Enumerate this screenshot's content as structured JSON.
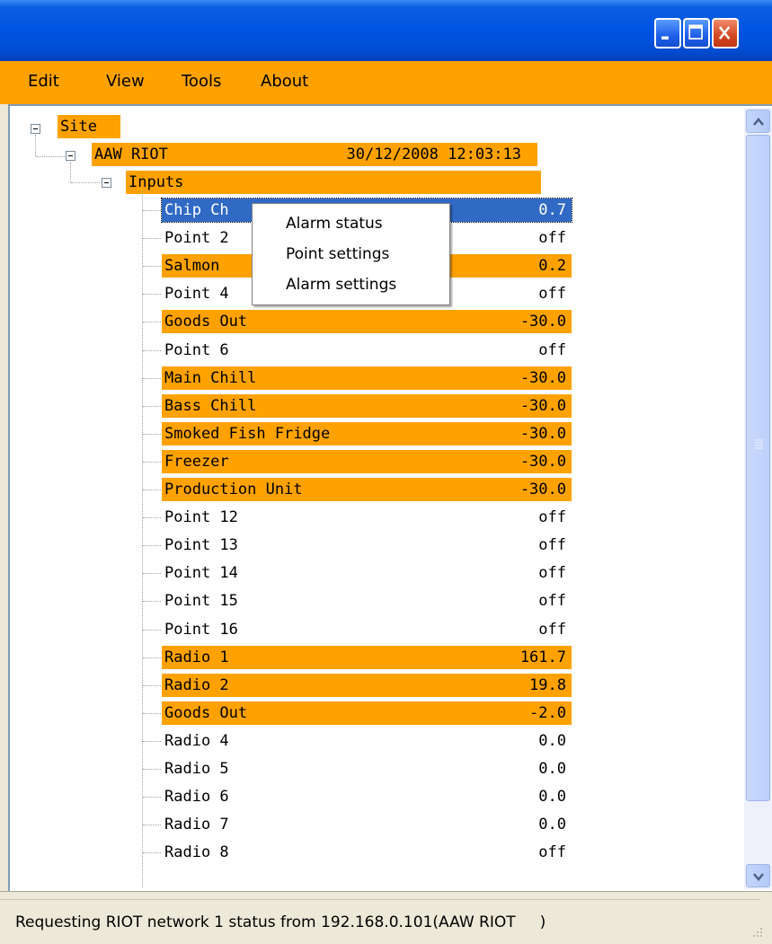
{
  "window": {
    "title": "",
    "controls": {
      "minimize": "minimize-icon",
      "maximize": "maximize-icon",
      "close": "close-icon"
    }
  },
  "menu": [
    {
      "label": "Edit"
    },
    {
      "label": "View"
    },
    {
      "label": "Tools"
    },
    {
      "label": "About"
    }
  ],
  "tree": {
    "root": {
      "label": "Site"
    },
    "device": {
      "label": "AAW RIOT",
      "timestamp": "30/12/2008 12:03:13"
    },
    "group": {
      "label": "Inputs"
    },
    "items": [
      {
        "label": "Chip Ch",
        "value": "0.7",
        "state": "selected"
      },
      {
        "label": "Point 2",
        "value": "off",
        "state": "normal"
      },
      {
        "label": "Salmon",
        "value": "0.2",
        "state": "highlight"
      },
      {
        "label": "Point 4",
        "value": "off",
        "state": "normal"
      },
      {
        "label": "Goods Out",
        "value": "-30.0",
        "state": "highlight"
      },
      {
        "label": "Point 6",
        "value": "off",
        "state": "normal"
      },
      {
        "label": "Main Chill",
        "value": "-30.0",
        "state": "highlight"
      },
      {
        "label": "Bass Chill",
        "value": "-30.0",
        "state": "highlight"
      },
      {
        "label": "Smoked Fish Fridge",
        "value": "-30.0",
        "state": "highlight"
      },
      {
        "label": "Freezer",
        "value": "-30.0",
        "state": "highlight"
      },
      {
        "label": "Production Unit",
        "value": "-30.0",
        "state": "highlight"
      },
      {
        "label": "Point 12",
        "value": "off",
        "state": "normal"
      },
      {
        "label": "Point 13",
        "value": "off",
        "state": "normal"
      },
      {
        "label": "Point 14",
        "value": "off",
        "state": "normal"
      },
      {
        "label": "Point 15",
        "value": "off",
        "state": "normal"
      },
      {
        "label": "Point 16",
        "value": "off",
        "state": "normal"
      },
      {
        "label": "Radio 1",
        "value": "161.7",
        "state": "highlight"
      },
      {
        "label": "Radio 2",
        "value": "19.8",
        "state": "highlight"
      },
      {
        "label": "Goods Out",
        "value": "-2.0",
        "state": "highlight"
      },
      {
        "label": "Radio 4",
        "value": "0.0",
        "state": "normal"
      },
      {
        "label": "Radio 5",
        "value": "0.0",
        "state": "normal"
      },
      {
        "label": "Radio 6",
        "value": "0.0",
        "state": "normal"
      },
      {
        "label": "Radio 7",
        "value": "0.0",
        "state": "normal"
      },
      {
        "label": "Radio 8",
        "value": "off",
        "state": "normal"
      }
    ]
  },
  "context_menu": {
    "items": [
      {
        "label": "Alarm status"
      },
      {
        "label": "Point settings"
      },
      {
        "label": "Alarm settings"
      }
    ]
  },
  "status": {
    "text": "Requesting RIOT network 1 status from 192.168.0.101(AAW RIOT     )"
  },
  "colors": {
    "highlight": "#ffa200",
    "selected": "#316ac5",
    "titlebar": "#0054e3"
  }
}
